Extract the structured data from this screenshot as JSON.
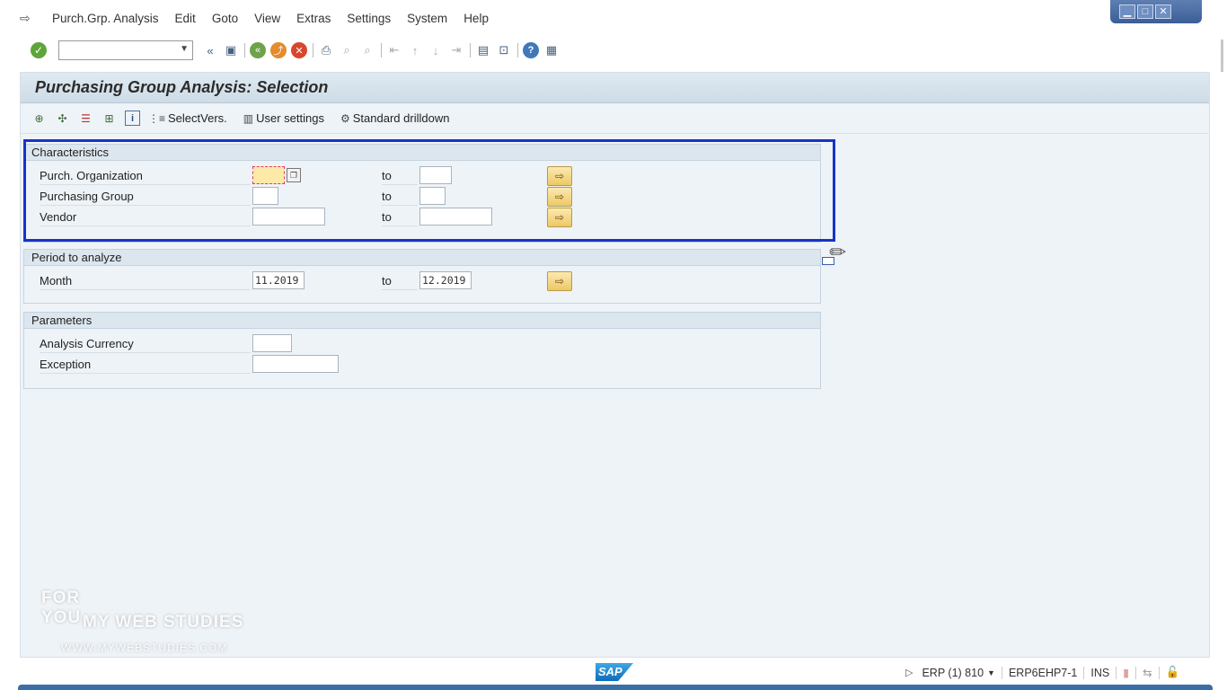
{
  "menubar": {
    "items": [
      "Purch.Grp. Analysis",
      "Edit",
      "Goto",
      "View",
      "Extras",
      "Settings",
      "System",
      "Help"
    ]
  },
  "window_controls": {
    "minimize": "▁",
    "maximize": "□",
    "close": "✕"
  },
  "toolbar": {
    "command_value": ""
  },
  "page": {
    "title": "Purchasing Group Analysis: Selection"
  },
  "app_toolbar": {
    "select_versions": "SelectVers.",
    "user_settings": "User settings",
    "standard_drilldown": "Standard drilldown"
  },
  "characteristics": {
    "title": "Characteristics",
    "rows": [
      {
        "label": "Purch. Organization",
        "from": "",
        "to_label": "to",
        "to": ""
      },
      {
        "label": "Purchasing Group",
        "from": "",
        "to_label": "to",
        "to": ""
      },
      {
        "label": "Vendor",
        "from": "",
        "to_label": "to",
        "to": ""
      }
    ]
  },
  "period": {
    "title": "Period to analyze",
    "rows": [
      {
        "label": "Month",
        "from": "11.2019",
        "to_label": "to",
        "to": "12.2019"
      }
    ]
  },
  "parameters": {
    "title": "Parameters",
    "rows": [
      {
        "label": "Analysis Currency",
        "value": ""
      },
      {
        "label": "Exception",
        "value": ""
      }
    ]
  },
  "watermark": {
    "line1": "FOR YOU",
    "line2": "MY WEB STUDIES",
    "line3": "WWW.MYWEBSTUDIES.COM"
  },
  "statusbar": {
    "logo": "SAP",
    "system": "ERP (1) 810",
    "server": "ERP6EHP7-1",
    "mode": "INS"
  },
  "colors": {
    "highlight_border": "#1732c9",
    "panel_background": "#eef3f7",
    "multi_select_button": "#eec866"
  }
}
